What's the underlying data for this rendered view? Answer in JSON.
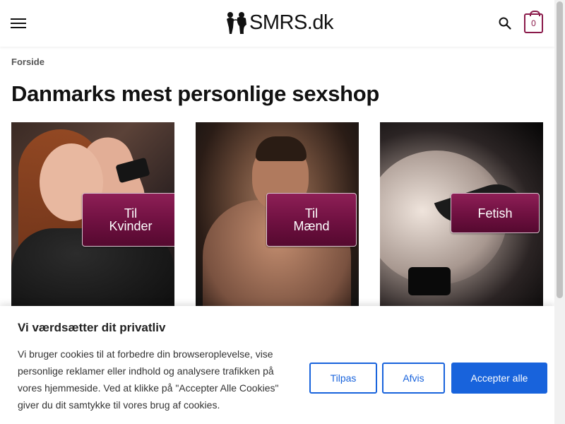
{
  "header": {
    "logo_text": "SMRS.dk",
    "cart_count": "0",
    "icons": {
      "menu": "hamburger-menu-icon",
      "search": "search-icon",
      "cart": "shopping-bag-icon",
      "logo": "silhouettes-logo-icon"
    }
  },
  "breadcrumb": {
    "home": "Forside"
  },
  "page": {
    "title": "Danmarks mest personlige sexshop"
  },
  "categories": [
    {
      "line1": "Til",
      "line2": "Kvinder"
    },
    {
      "line1": "Til",
      "line2": "Mænd"
    },
    {
      "line1": "Fetish",
      "line2": ""
    }
  ],
  "cookie_banner": {
    "title": "Vi værdsætter dit privatliv",
    "text": "Vi bruger cookies til at forbedre din browseroplevelse, vise personlige reklamer eller indhold og analysere trafikken på vores hjemmeside. Ved at klikke på \"Accepter Alle Cookies\" giver du dit samtykke til vores brug af cookies.",
    "customize_label": "Tilpas",
    "reject_label": "Afvis",
    "accept_label": "Accepter alle"
  },
  "colors": {
    "brand": "#7a1547",
    "accent_blue": "#1863dc"
  }
}
